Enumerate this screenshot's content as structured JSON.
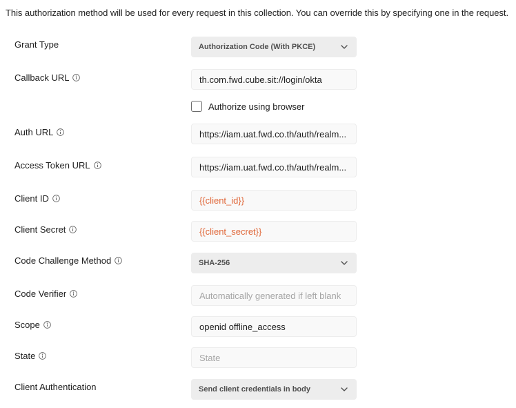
{
  "notice": "This authorization method will be used for every request in this collection. You can override this by specifying one in the request.",
  "fields": {
    "grant_type": {
      "label": "Grant Type",
      "value": "Authorization Code (With PKCE)"
    },
    "callback_url": {
      "label": "Callback URL",
      "value": "th.com.fwd.cube.sit://login/okta"
    },
    "authorize_browser": {
      "label": "Authorize using browser",
      "checked": false
    },
    "auth_url": {
      "label": "Auth URL",
      "value": "https://iam.uat.fwd.co.th/auth/realm..."
    },
    "access_token_url": {
      "label": "Access Token URL",
      "value": "https://iam.uat.fwd.co.th/auth/realm..."
    },
    "client_id": {
      "label": "Client ID",
      "value": "{{client_id}}"
    },
    "client_secret": {
      "label": "Client Secret",
      "value": "{{client_secret}}"
    },
    "code_challenge_method": {
      "label": "Code Challenge Method",
      "value": "SHA-256"
    },
    "code_verifier": {
      "label": "Code Verifier",
      "placeholder": "Automatically generated if left blank"
    },
    "scope": {
      "label": "Scope",
      "value": "openid offline_access"
    },
    "state": {
      "label": "State",
      "placeholder": "State"
    },
    "client_authentication": {
      "label": "Client Authentication",
      "value": "Send client credentials in body"
    }
  },
  "icons": {
    "info": "info-icon",
    "dropdown": "chevron-down-icon"
  },
  "colors": {
    "variable_text": "#e0683a",
    "select_bg": "#ededed",
    "input_bg": "#f9f9f9",
    "placeholder": "#a6a6a6"
  }
}
